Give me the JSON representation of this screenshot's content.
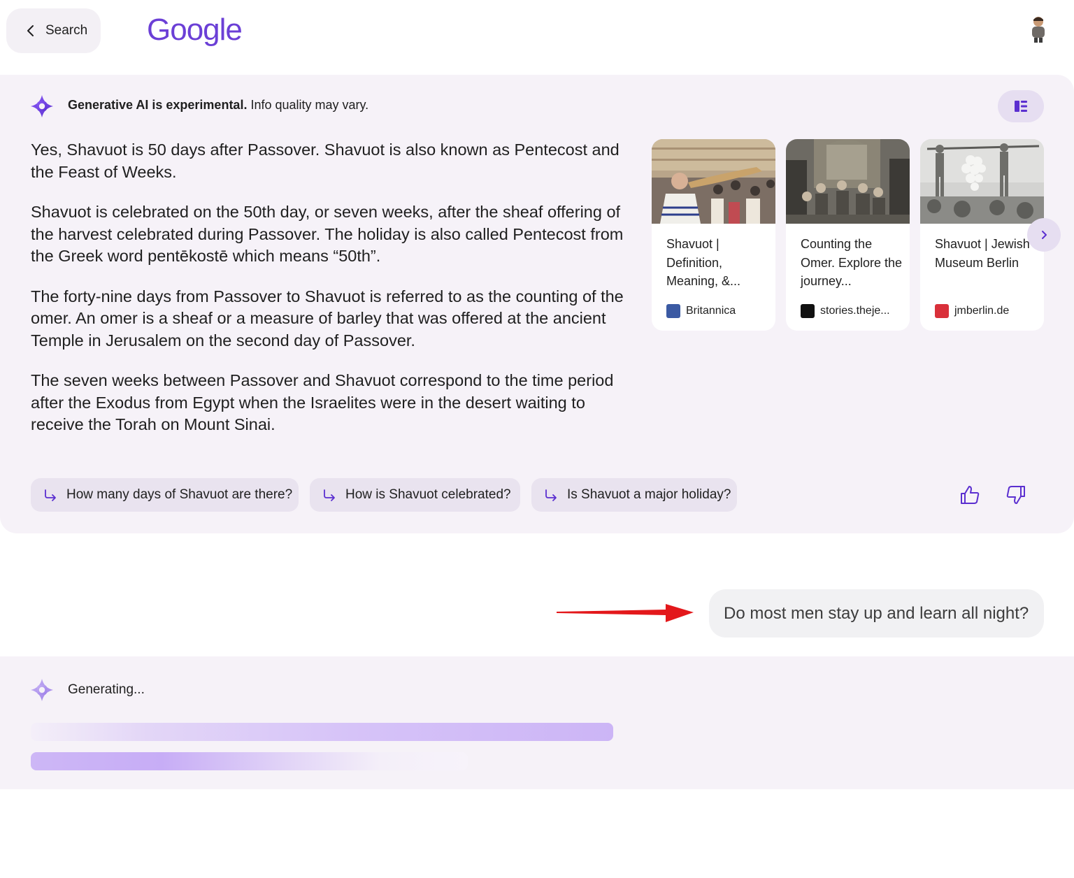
{
  "header": {
    "back_label": "Search",
    "logo_text": "Google"
  },
  "ai_overview": {
    "notice_bold": "Generative AI is experimental.",
    "notice_rest": " Info quality may vary.",
    "paragraphs": [
      "Yes, Shavuot is 50 days after Passover. Shavuot is also known as Pentecost and the Feast of Weeks.",
      "Shavuot is celebrated on the 50th day, or seven weeks, after the sheaf offering of the harvest celebrated during Passover. The holiday is also called Pentecost from the Greek word pentēkostē which means “50th”.",
      "The forty-nine days from Passover to Shavuot is referred to as the counting of the omer. An omer is a sheaf or a measure of barley that was offered at the ancient Temple in Jerusalem on the second day of Passover.",
      "The seven weeks between Passover and Shavuot correspond to the time period after the Exodus from Egypt when the Israelites were in the desert waiting to receive the Torah on Mount Sinai."
    ],
    "sources": [
      {
        "title": "Shavuot | Definition, Meaning, &...",
        "site": "Britannica",
        "favicon_color": "#3b5aa3"
      },
      {
        "title": "Counting the Omer. Explore the journey...",
        "site": "stories.theje...",
        "favicon_color": "#111111"
      },
      {
        "title": "Shavuot | Jewish Museum Berlin",
        "site": "jmberlin.de",
        "favicon_color": "#d9303a"
      }
    ],
    "followups": [
      "How many days of Shavuot are there?",
      "How is Shavuot celebrated?",
      "Is Shavuot a major holiday?"
    ]
  },
  "user_query": "Do most men stay up and learn all night?",
  "generating_label": "Generating...",
  "colors": {
    "accent": "#6b3fd6",
    "panel_bg": "#f6f2f8",
    "chip_bg": "#e9e3ef",
    "arrow": "#e3181b"
  }
}
